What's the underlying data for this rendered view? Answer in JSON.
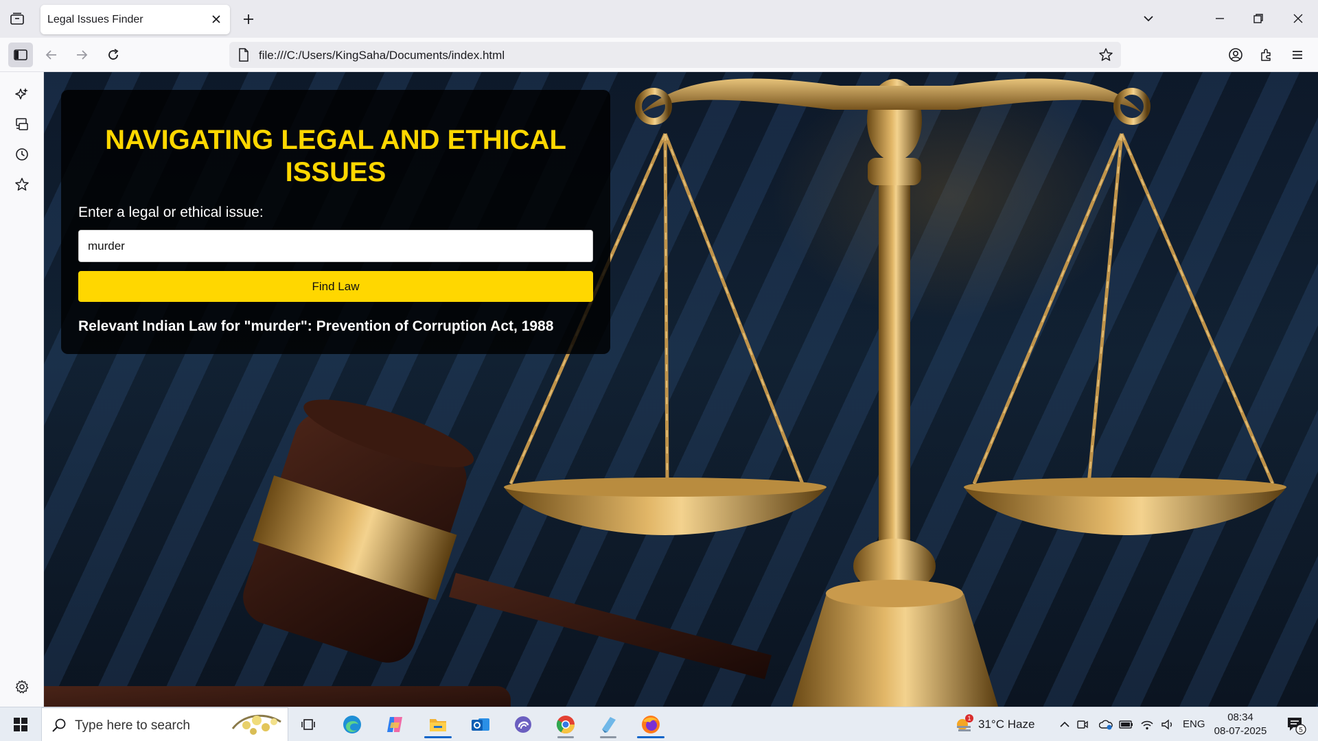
{
  "browser": {
    "tab_title": "Legal Issues Finder",
    "url": "file:///C:/Users/KingSaha/Documents/index.html"
  },
  "page": {
    "title": "NAVIGATING LEGAL AND ETHICAL ISSUES",
    "input_label": "Enter a legal or ethical issue:",
    "input_value": "murder",
    "button_label": "Find Law",
    "result_text": "Relevant Indian Law for \"murder\": Prevention of Corruption Act, 1988",
    "accent_color": "#ffd700"
  },
  "sidebar": {
    "items": [
      "sidebar-toggle-icon",
      "ai-chatbot-icon",
      "synced-tabs-icon",
      "history-icon",
      "bookmarks-icon",
      "settings-icon"
    ]
  },
  "taskbar": {
    "search_placeholder": "Type here to search",
    "weather_badge": "1",
    "weather": "31°C  Haze",
    "language": "ENG",
    "time": "08:34",
    "date": "08-07-2025",
    "notification_count": "5",
    "pinned_apps": [
      "task-view-icon",
      "edge-icon",
      "copilot-icon",
      "file-explorer-icon",
      "outlook-icon",
      "app-icon",
      "chrome-icon",
      "notepad-icon",
      "firefox-icon"
    ]
  }
}
